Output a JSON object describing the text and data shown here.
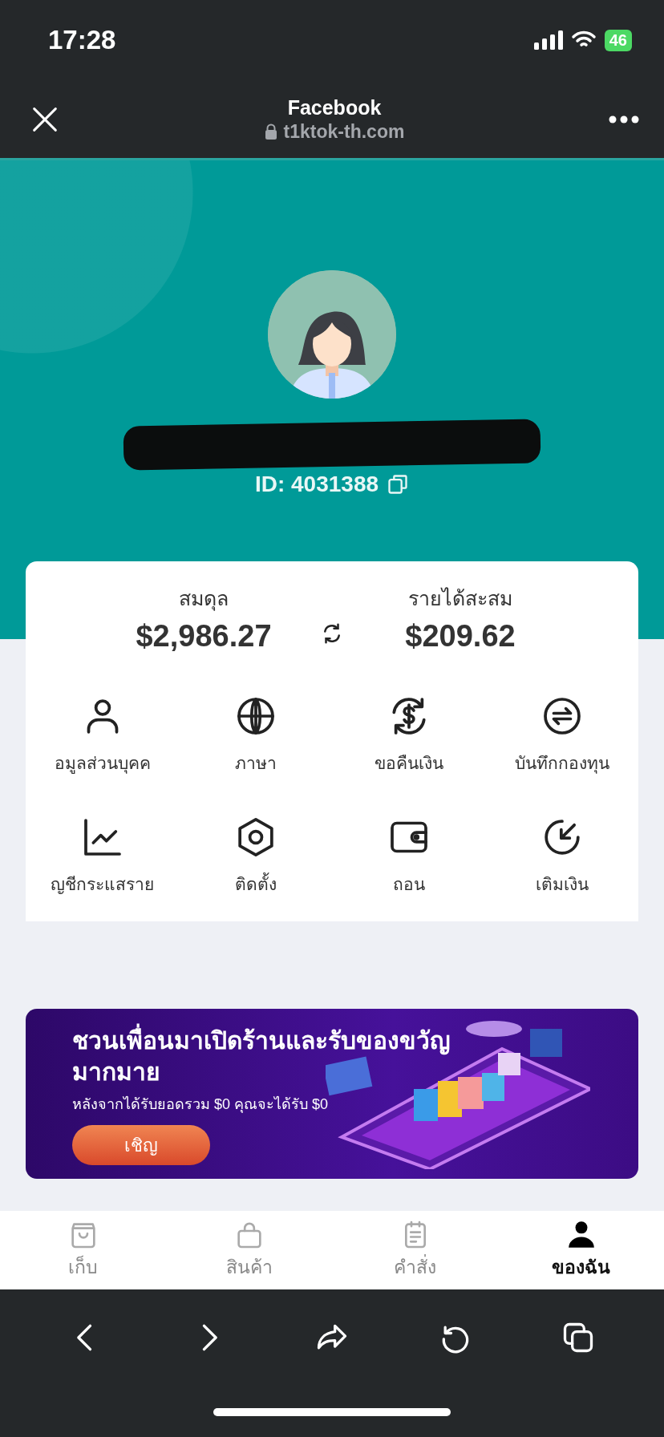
{
  "status_bar": {
    "time": "17:28",
    "battery": "46"
  },
  "browser_header": {
    "title": "Facebook",
    "url": "t1ktok-th.com"
  },
  "profile": {
    "id_text": "ID: 4031388"
  },
  "balances": [
    {
      "label": "สมดุล",
      "amount": "$2,986.27"
    },
    {
      "label": "รายได้สะสม",
      "amount": "$209.62"
    }
  ],
  "menu": [
    {
      "kind": "person",
      "label": "อมูลส่วนบุคค"
    },
    {
      "kind": "globe",
      "label": "ภาษา"
    },
    {
      "kind": "refund",
      "label": "ขอคืนเงิน"
    },
    {
      "kind": "exchange",
      "label": "บันทึกกองทุน"
    },
    {
      "kind": "chart",
      "label": "ญชีกระแสราย"
    },
    {
      "kind": "hexagon",
      "label": "ติดตั้ง"
    },
    {
      "kind": "wallet",
      "label": "ถอน"
    },
    {
      "kind": "deposit",
      "label": "เติมเงิน"
    }
  ],
  "banner": {
    "title": "ชวนเพื่อนมาเปิดร้านและรับของขวัญมากมาย",
    "subtitle": "หลังจากได้รับยอดรวม $0 คุณจะได้รับ $0",
    "button": "เชิญ"
  },
  "tabs": [
    {
      "kind": "bag",
      "label": "เก็บ",
      "selected": false
    },
    {
      "kind": "lock-bag",
      "label": "สินค้า",
      "selected": false
    },
    {
      "kind": "notepad",
      "label": "คำสั่ง",
      "selected": false
    },
    {
      "kind": "person",
      "label": "ของฉัน",
      "selected": true
    }
  ]
}
